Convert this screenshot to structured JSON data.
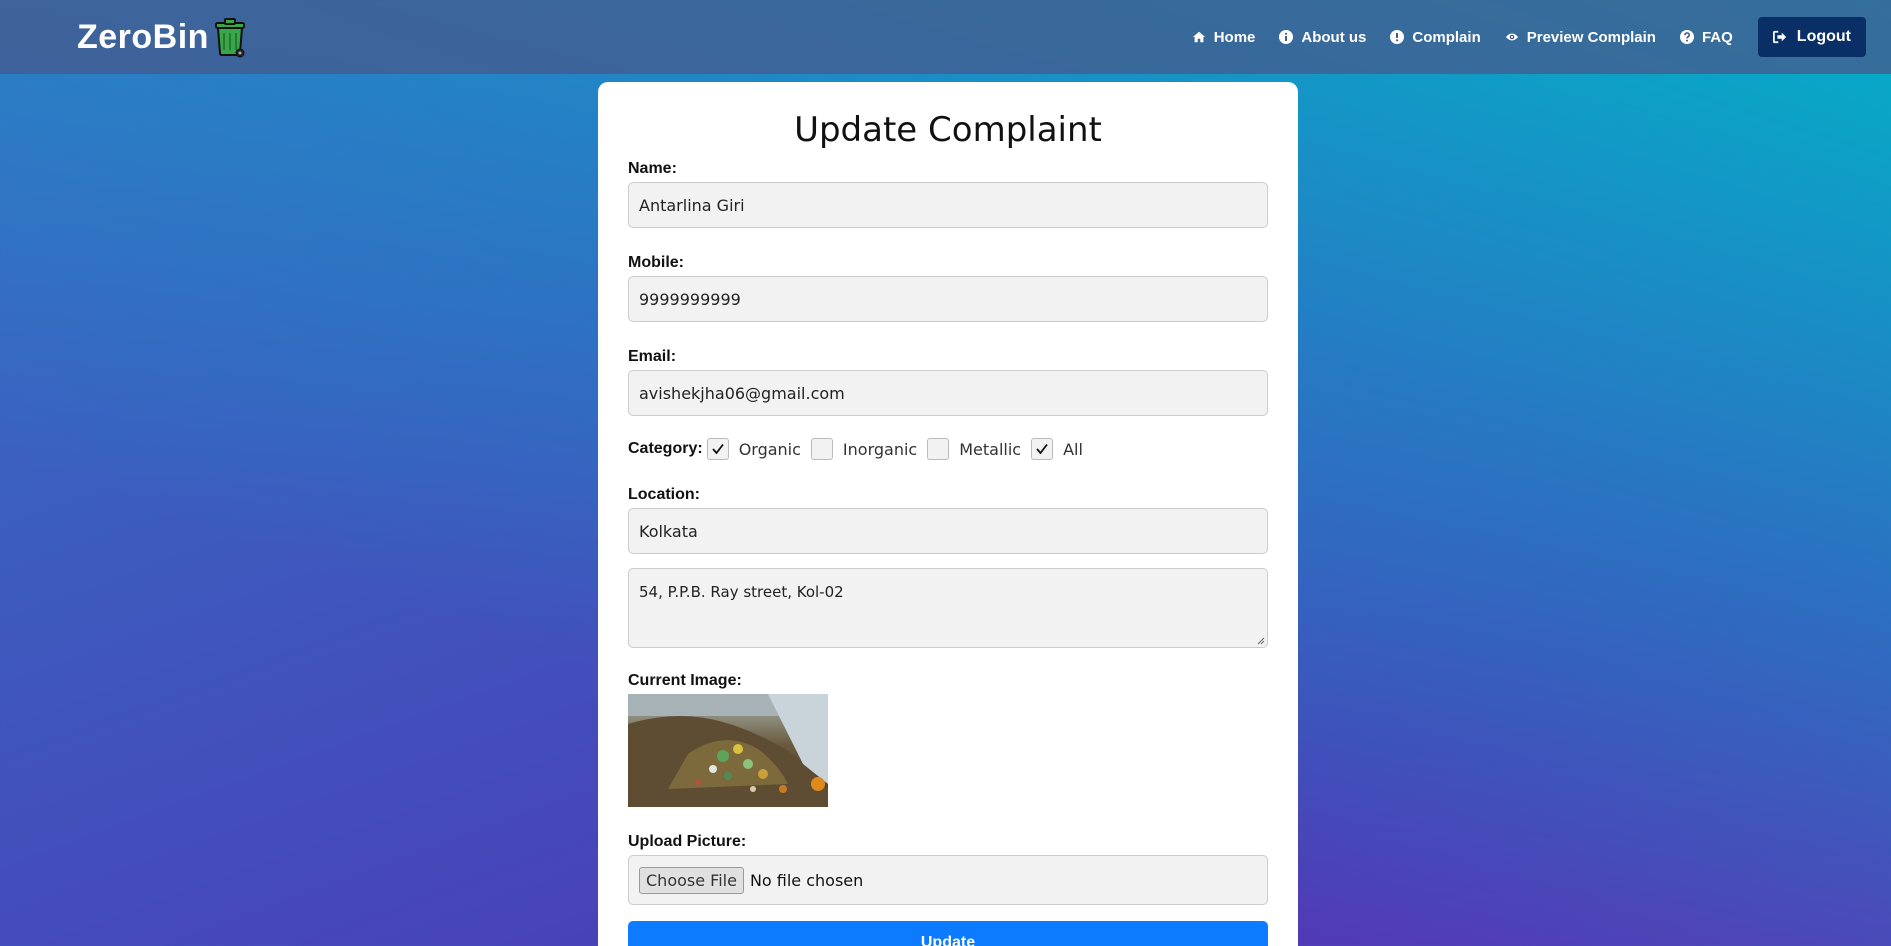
{
  "brand": {
    "name": "ZeroBin",
    "icon": "trash-bin-icon"
  },
  "nav": {
    "items": [
      {
        "label": "Home",
        "icon": "home-icon"
      },
      {
        "label": "About us",
        "icon": "info-icon"
      },
      {
        "label": "Complain",
        "icon": "exclamation-icon"
      },
      {
        "label": "Preview Complain",
        "icon": "eye-icon"
      },
      {
        "label": "FAQ",
        "icon": "question-icon"
      }
    ],
    "logout_label": "Logout",
    "logout_icon": "logout-icon"
  },
  "form": {
    "title": "Update Complaint",
    "name_label": "Name:",
    "name_value": "Antarlina Giri",
    "mobile_label": "Mobile:",
    "mobile_value": "9999999999",
    "email_label": "Email:",
    "email_value": "avishekjha06@gmail.com",
    "category_label": "Category:",
    "categories": [
      {
        "label": "Organic",
        "checked": true
      },
      {
        "label": "Inorganic",
        "checked": false
      },
      {
        "label": "Metallic",
        "checked": false
      },
      {
        "label": "All",
        "checked": true
      }
    ],
    "location_label": "Location:",
    "location_value": "Kolkata",
    "address_value": "54, P.P.B. Ray street, Kol-02",
    "current_image_label": "Current Image:",
    "upload_label": "Upload Picture:",
    "choose_file_label": "Choose File",
    "no_file_text": "No file chosen",
    "submit_label": "Update"
  },
  "colors": {
    "navbar": "#465a8c",
    "logout_bg": "#0a2e66",
    "primary": "#0d7bff",
    "bin_green": "#3aa64a"
  }
}
